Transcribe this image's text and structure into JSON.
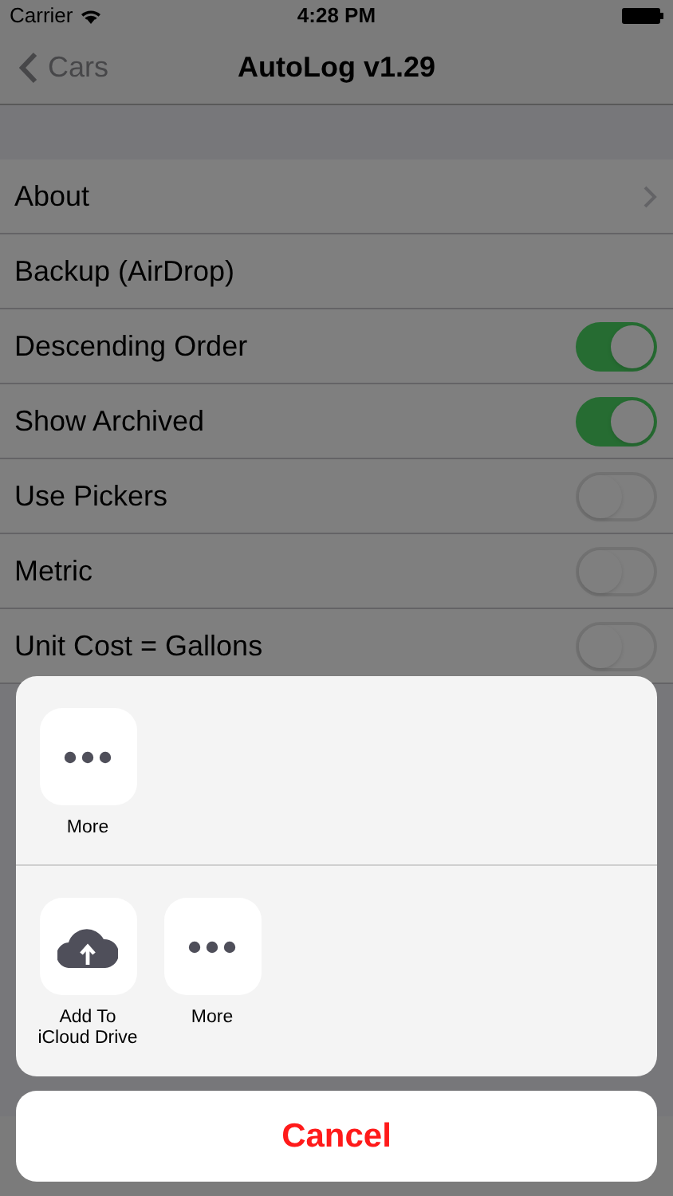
{
  "status_bar": {
    "carrier": "Carrier",
    "time": "4:28 PM"
  },
  "nav": {
    "back": "Cars",
    "title": "AutoLog v1.29"
  },
  "rows": [
    {
      "kind": "disclosure",
      "label": "About"
    },
    {
      "kind": "plain",
      "label": "Backup (AirDrop)"
    },
    {
      "kind": "toggle",
      "label": "Descending Order",
      "on": true
    },
    {
      "kind": "toggle",
      "label": "Show Archived",
      "on": true
    },
    {
      "kind": "toggle",
      "label": "Use Pickers",
      "on": false
    },
    {
      "kind": "toggle",
      "label": "Metric",
      "on": false
    },
    {
      "kind": "toggle",
      "label": "Unit Cost = Gallons",
      "on": false
    }
  ],
  "share_sheet": {
    "top_row": [
      {
        "kind": "more",
        "label": "More"
      }
    ],
    "bottom_row": [
      {
        "kind": "cloud",
        "label": "Add To\niCloud Drive"
      },
      {
        "kind": "more",
        "label": "More"
      }
    ],
    "cancel": "Cancel"
  }
}
